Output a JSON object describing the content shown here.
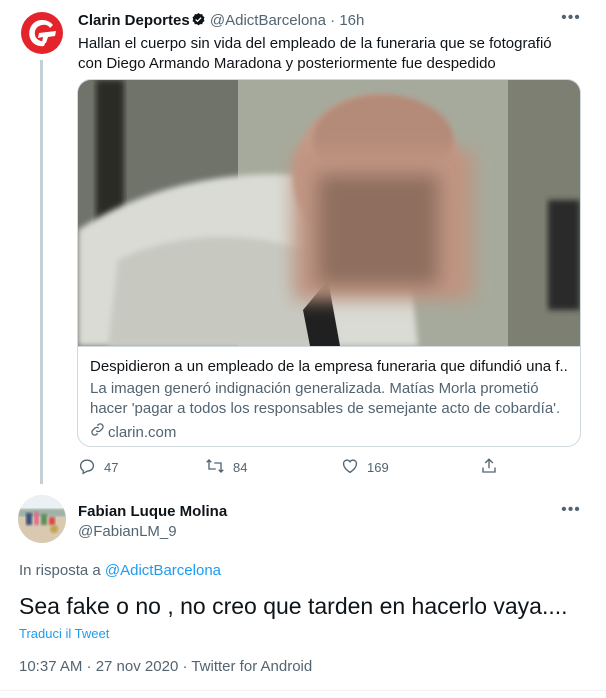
{
  "tweet": {
    "author": {
      "name": "Clarin Deportes",
      "handle": "@AdictBarcelona",
      "separator": "·",
      "time": "16h",
      "logo_color": "#e3242b"
    },
    "text": "Hallan el cuerpo sin vida del empleado de la funeraria que se fotografió con Diego Armando Maradona y posteriormente fue despedido",
    "card": {
      "title": "Despidieron a un empleado de la empresa funeraria que difundió una f...",
      "description": "La imagen generó indignación generalizada. Matías Morla prometió hacer 'pagar a todos los responsables de semejante acto de cobardía'.",
      "domain": "clarin.com"
    },
    "actions": {
      "replies": "47",
      "retweets": "84",
      "likes": "169"
    }
  },
  "reply": {
    "author": {
      "name": "Fabian Luque Molina",
      "handle": "@FabianLM_9"
    },
    "replying_to_prefix": "In risposta a",
    "replying_to_handle": "@AdictBarcelona",
    "text": "Sea fake o no , no creo que tarden en hacerlo vaya....",
    "translate_label": "Traduci il Tweet",
    "meta": "10:37 AM · 27 nov 2020 · Twitter for Android"
  },
  "colors": {
    "link": "#1d9bf0",
    "secondary_text": "#536471",
    "border": "#cfd9de",
    "thread_line": "#c4cfd6"
  },
  "icons": [
    "verified-icon",
    "more-icon",
    "link-icon",
    "reply-icon",
    "retweet-icon",
    "like-icon",
    "share-icon"
  ]
}
